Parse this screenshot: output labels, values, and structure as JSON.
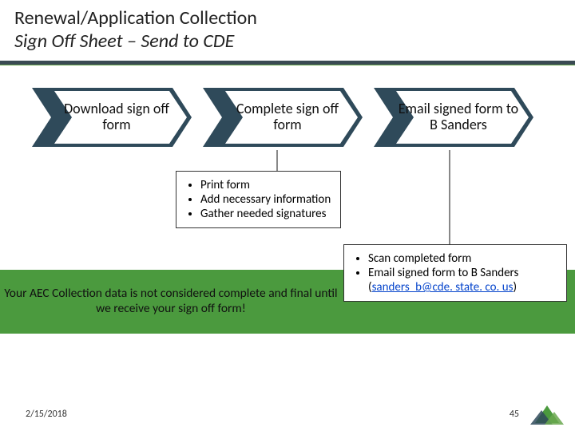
{
  "title": {
    "line1": "Renewal/Application Collection",
    "line2": "Sign Off Sheet – Send to CDE"
  },
  "steps": [
    {
      "label": "Download sign off form"
    },
    {
      "label": "Complete sign off form"
    },
    {
      "label": "Email signed form to B Sanders"
    }
  ],
  "callout1": {
    "items": [
      "Print form",
      "Add necessary information",
      "Gather needed signatures"
    ]
  },
  "callout2": {
    "prefix": "Scan completed form",
    "line2a": "Email signed form to B Sanders (",
    "email": "sanders_b@cde. state. co. us",
    "line2b": ")"
  },
  "disclaimer": "Your AEC Collection data is not considered complete and final until we receive your sign off form!",
  "footer": {
    "date": "2/15/2018",
    "page": "45"
  },
  "colors": {
    "chevron_fill": "#2f4a5a",
    "chevron_face": "#ffffff"
  }
}
